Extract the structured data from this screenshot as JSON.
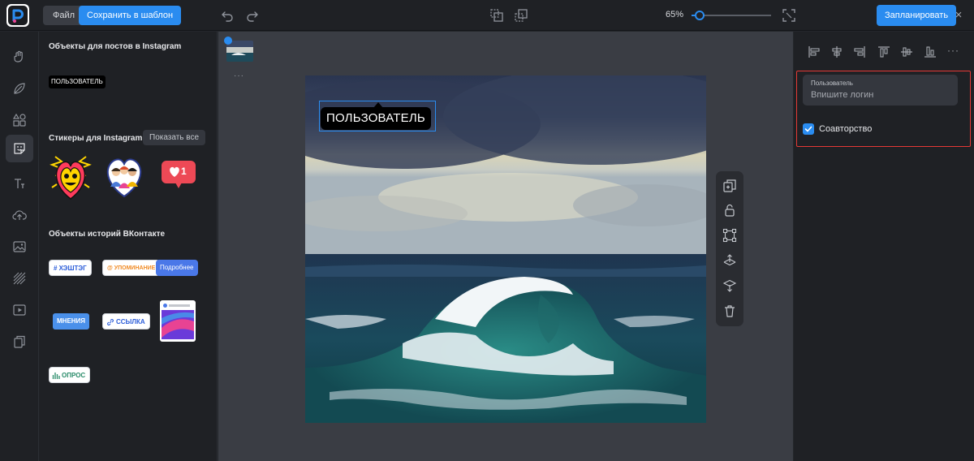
{
  "topbar": {
    "file_label": "Файл",
    "save_template_label": "Сохранить в шаблон",
    "zoom_label": "65%",
    "zoom_level_percent": 65,
    "schedule_label": "Запланировать",
    "close_glyph": "×"
  },
  "rail": {
    "icons": [
      "hand-icon",
      "shapes-icon",
      "elements-icon",
      "stickers-icon",
      "text-icon",
      "upload-icon",
      "image-icon",
      "texture-icon",
      "video-icon",
      "duplicate-icon"
    ],
    "active_index": 3
  },
  "panel": {
    "instagram_posts_title": "Объекты для постов в Instagram",
    "user_sticker_text": "ПОЛЬЗОВАТЕЛЬ",
    "instagram_stickers_title": "Стикеры для Instagram",
    "show_all_label": "Показать все",
    "like_count": "1",
    "vk_title": "Объекты историй ВКонтакте",
    "vk_items": {
      "hashtag": "# ХЭШТЭГ",
      "mention": "@ УПОМИНАНИЕ",
      "more": "Подробнее",
      "opinions": "МНЕНИЯ",
      "link": "ССЫЛКА",
      "poll": "ОПРОС"
    }
  },
  "canvas": {
    "thumb_more": "···",
    "user_label": "ПОЛЬЗОВАТЕЛЬ"
  },
  "right": {
    "field_label": "Пользователь",
    "field_placeholder": "Впишите логин",
    "coauthor_label": "Соавторство",
    "coauthor_checked": true,
    "more_glyph": "···"
  },
  "colors": {
    "accent": "#2a8cf0",
    "highlight": "#e53935",
    "background": "#1f2125",
    "canvas": "#3a3d44"
  }
}
